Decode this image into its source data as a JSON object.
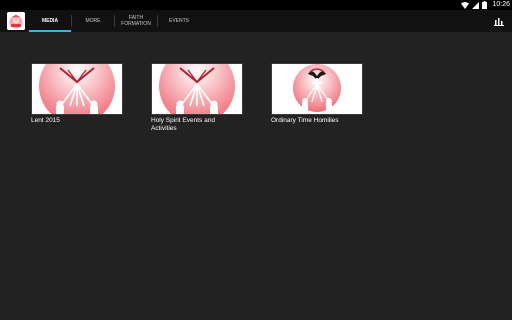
{
  "status_bar": {
    "time": "10:26"
  },
  "app_bar": {
    "tabs": [
      {
        "label": "MEDIA",
        "active": true
      },
      {
        "label": "MORE",
        "active": false
      },
      {
        "label": "FAITH FORMATION",
        "active": false
      },
      {
        "label": "EVENTS",
        "active": false
      }
    ]
  },
  "media": {
    "items": [
      {
        "title": "Lent 2015",
        "thumbnail": "dove-emblem"
      },
      {
        "title": "Holy Spirit Events and Activities",
        "thumbnail": "dove-emblem"
      },
      {
        "title": "Ordinary Time Homilies",
        "thumbnail": "dove-emblem-with-cross"
      }
    ]
  },
  "colors": {
    "accent": "#33b5e5",
    "background": "#222222",
    "app_bar": "#111111",
    "emblem": "#e03a4a"
  }
}
